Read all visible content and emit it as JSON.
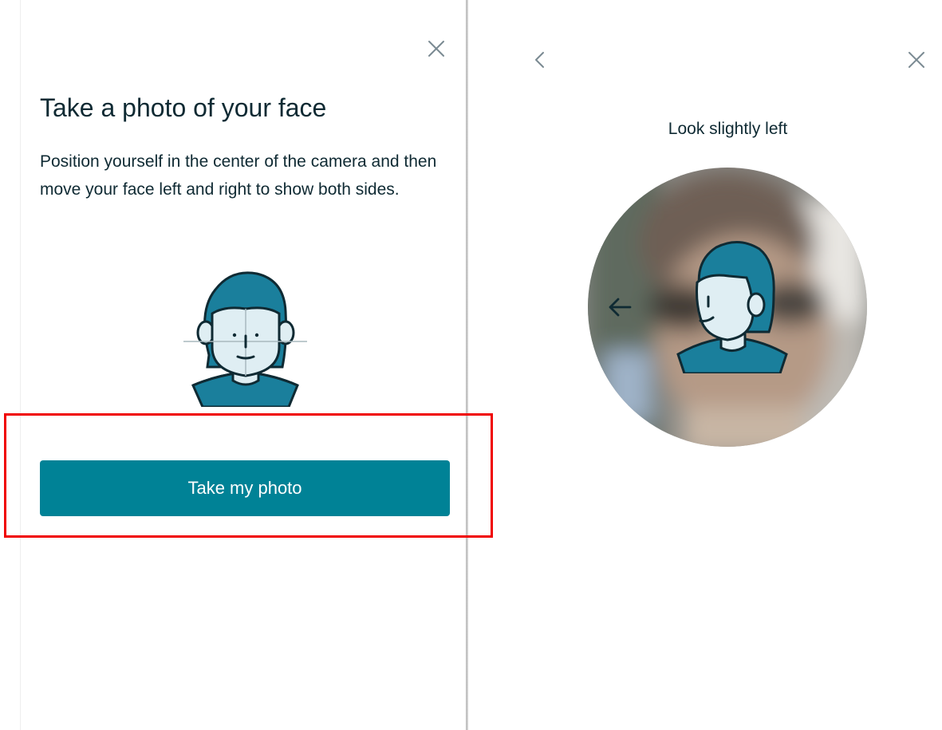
{
  "left_panel": {
    "close_icon": "close-icon",
    "title": "Take a photo of your face",
    "description": "Position yourself in the center of the camera and then move your face left and right to show both sides.",
    "illustration_icon": "face-outline-icon",
    "primary_button_label": "Take my photo",
    "highlight_color": "#f00000"
  },
  "right_panel": {
    "back_icon": "chevron-left-icon",
    "close_icon": "close-icon",
    "instruction": "Look slightly left",
    "direction_icon": "arrow-left-icon",
    "overlay_icon": "face-turn-left-icon"
  },
  "colors": {
    "accent": "#008296",
    "text": "#0f2a33",
    "illustration_hair": "#1a7f9c",
    "illustration_skin": "#dfeef3"
  }
}
